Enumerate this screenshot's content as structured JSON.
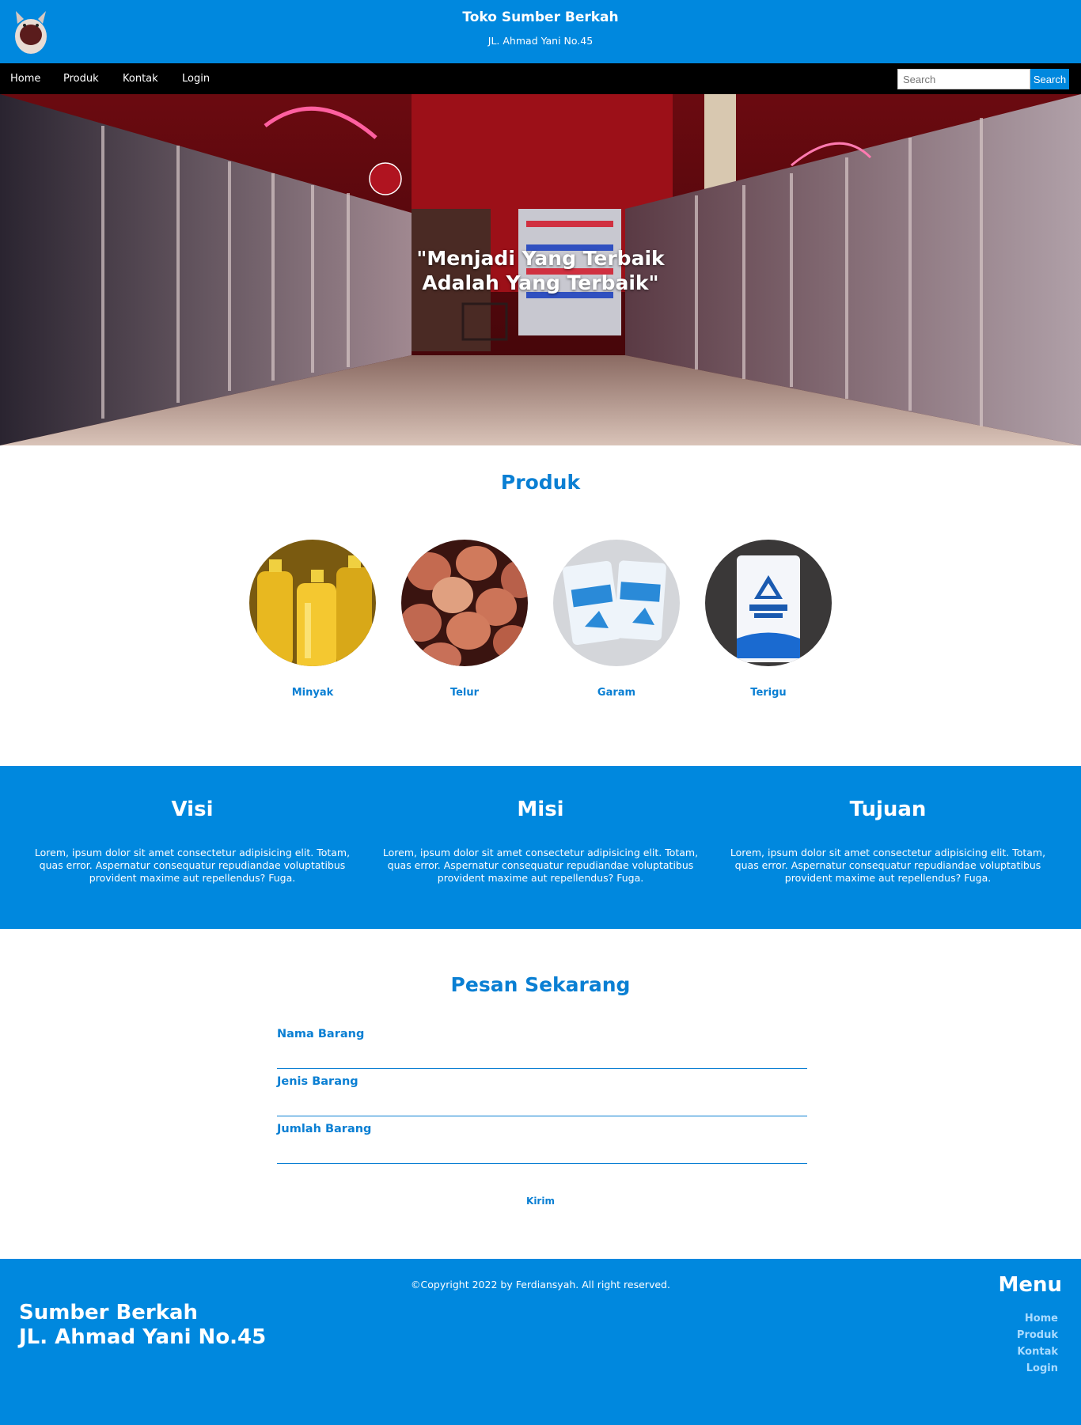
{
  "header": {
    "title": "Toko Sumber Berkah",
    "subtitle": "JL. Ahmad Yani No.45"
  },
  "nav": {
    "links": [
      "Home",
      "Produk",
      "Kontak",
      "Login"
    ],
    "search_placeholder": "Search",
    "search_button": "Search"
  },
  "hero": {
    "quote_line1": "\"Menjadi Yang Terbaik",
    "quote_line2": "Adalah Yang Terbaik\""
  },
  "produk": {
    "title": "Produk",
    "items": [
      "Minyak",
      "Telur",
      "Garam",
      "Terigu"
    ]
  },
  "vmt": [
    {
      "title": "Visi",
      "text": "Lorem, ipsum dolor sit amet consectetur adipisicing elit. Totam, quas error. Aspernatur consequatur repudiandae voluptatibus provident maxime aut repellendus? Fuga."
    },
    {
      "title": "Misi",
      "text": "Lorem, ipsum dolor sit amet consectetur adipisicing elit. Totam, quas error. Aspernatur consequatur repudiandae voluptatibus provident maxime aut repellendus? Fuga."
    },
    {
      "title": "Tujuan",
      "text": "Lorem, ipsum dolor sit amet consectetur adipisicing elit. Totam, quas error. Aspernatur consequatur repudiandae voluptatibus provident maxime aut repellendus? Fuga."
    }
  ],
  "pesan": {
    "title": "Pesan Sekarang",
    "fields": [
      "Nama Barang",
      "Jenis Barang",
      "Jumlah Barang"
    ],
    "submit": "Kirim"
  },
  "footer": {
    "copyright": "©Copyright 2022 by Ferdiansyah. All right reserved.",
    "name_line1": "Sumber Berkah",
    "name_line2": "JL. Ahmad Yani No.45",
    "menu_title": "Menu",
    "menu": [
      "Home",
      "Produk",
      "Kontak",
      "Login"
    ]
  }
}
